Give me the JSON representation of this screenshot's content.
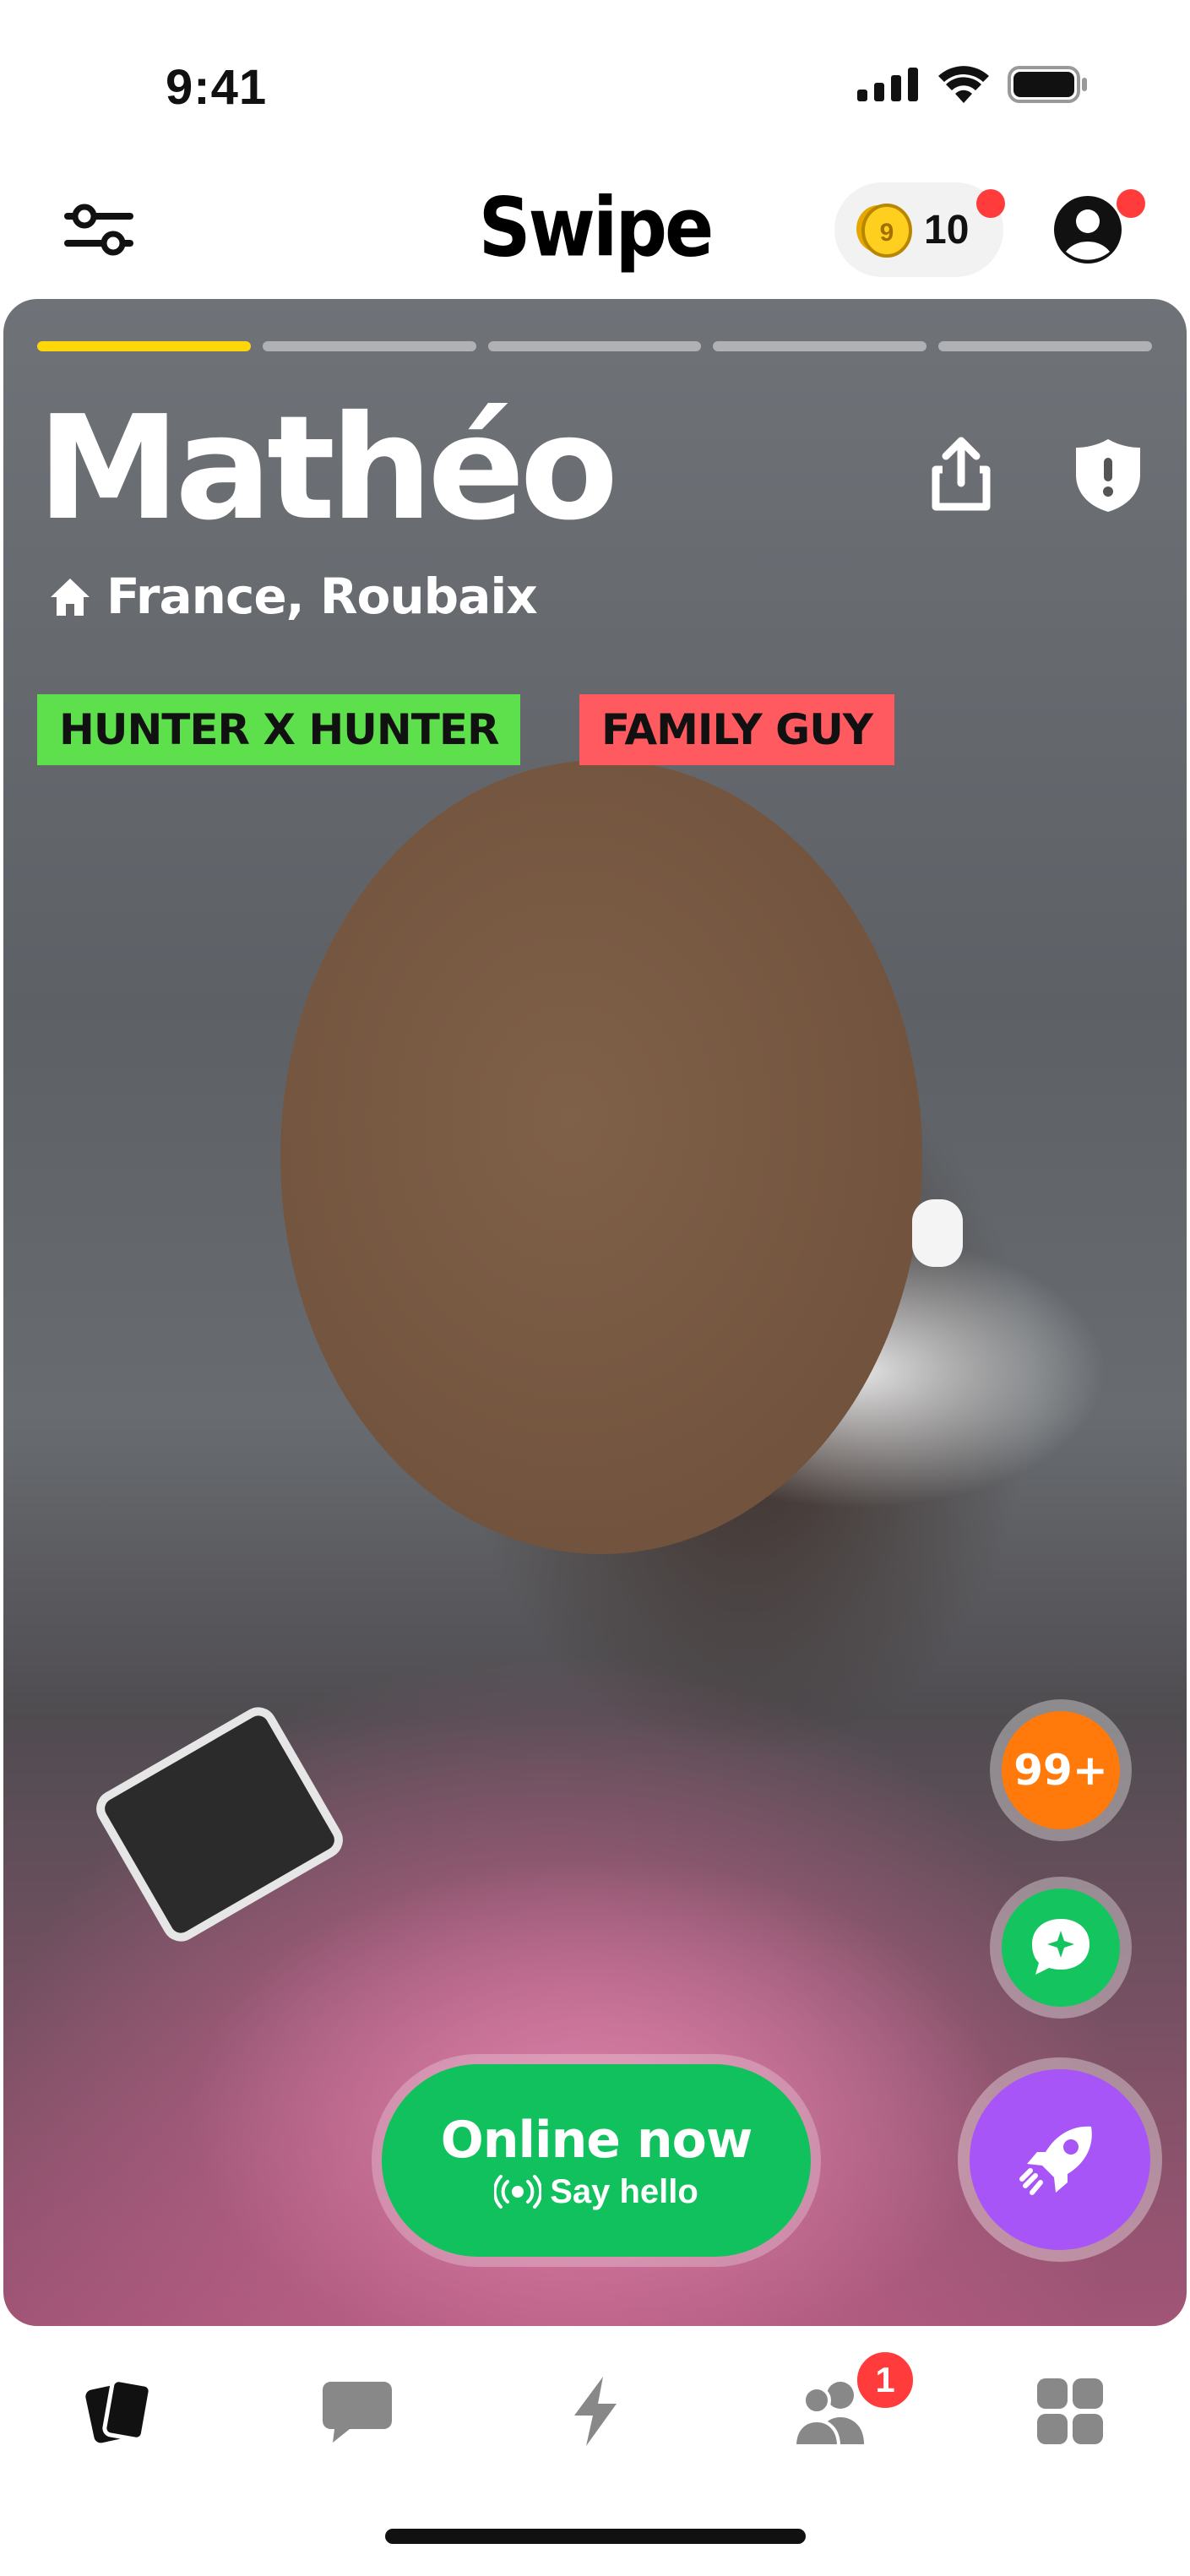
{
  "status_bar": {
    "time": "9:41"
  },
  "header": {
    "title": "Swipe",
    "coins": {
      "count": "10"
    }
  },
  "profile": {
    "name": "Mathéo",
    "location": "France, Roubaix",
    "photo_progress": {
      "total": 5,
      "active_index": 0
    },
    "tags": [
      {
        "label": "HUNTER X HUNTER",
        "color": "#5ee04d"
      },
      {
        "label": "FAMILY GUY",
        "color": "#ff5a5f"
      }
    ]
  },
  "actions": {
    "counter_label": "99+",
    "online_title": "Online now",
    "online_sub": "Say hello"
  },
  "tabbar": {
    "items": [
      "cards-icon",
      "messages-icon",
      "lightning-icon",
      "friends-icon",
      "grid-icon"
    ],
    "friends_badge": "1"
  },
  "colors": {
    "accent_yellow": "#ffd60a",
    "online_green": "#11c15d",
    "boost_purple": "#a855f7",
    "counter_orange": "#ff7a0a"
  }
}
